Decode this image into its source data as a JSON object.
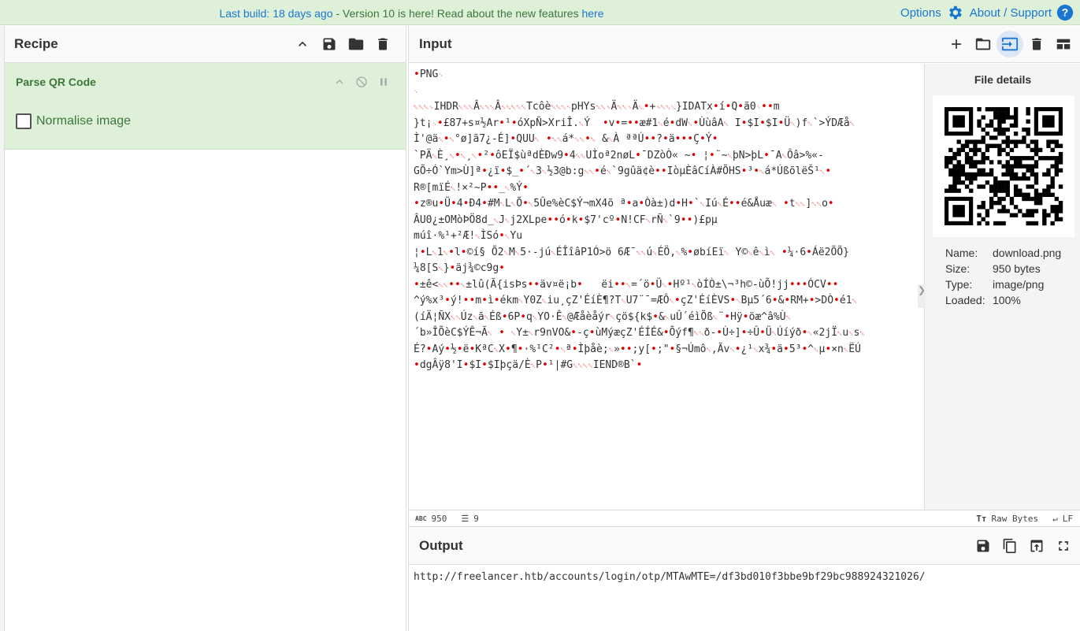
{
  "banner": {
    "last_build": "Last build: 18 days ago",
    "message": " - Version 10 is here! Read about the new features ",
    "link": "here",
    "options": "Options",
    "about": "About / Support"
  },
  "recipe": {
    "title": "Recipe",
    "operation": {
      "name": "Parse QR Code",
      "checkbox_label": "Normalise image"
    }
  },
  "input": {
    "title": "Input",
    "lines": [
      "•PNG␊",
      "␊",
      "␀␀␀␍IHDR␀␀␀Â␀␀␀Â␈␆␀␀␀Tcôè␀␀␀␉pHYs␀␀␎Ä␀␀␎Ä␁•+␎␀␀␃}IDATx•í•Q•ã0␌••m",
      "}t¡␌•£87+s¤½Ar•¹•óXpÑ>XriÎ.␀Ý  •v•=••æ#1␀é•dW␀•ÙùâA␀ I•$I•$I•Ü␀)f␀`>ÝDÆå␀",
      "Ì'@ä␀•␀°ø]ã7¿-É]•QUU␀ •␀␀á*␀␀•␀ &␀À ªªÚ••?•ä•••Ç•Ý•",
      "`PÄ␀È¸␀•␀¸␀•²•ôEÏ$ùªdÈÐw9•4␀␀UÌoª2nøL•¯DZòÒ« ~• ¦•¨~␀þN>þL•¯A␀Ôâ>%«-",
      "GÕ÷Ó`Ym>Ù]ª•¿ï•$_•´␀3␀½3@b:g␀␀•é␀`9gûä¢è••IòµÈâCíÀ#ÕHS•³•␀á*ÚßõlëŠ¹␀•",
      "R®[mïÉ␀!×²~P••_␀%Ý•",
      "•z®u•Ü•4•Ð4•#M␀L␀Õ•␀5Ûe%èC$Ý¬mX4õ ª•a•Òà±)d•H•`␀Iú␀É••é&Åuæ␀ •t␀␀]␀␀o•",
      "ÂU0¿±OMòÞÖ8d_␀J␀j2XLpe••ó•k•$7'cº•N!CF␀rÑ␀`9••)£pµ",
      "múî·%¹+²Æ!␀ÌSó•␀Yu",
      "¦•L␀1␀•l•©í§ Õ2␀M␀5·-jú␀ÉÎîâP1Ó>ö 6Æ¯␀␀ú␀ÉÖ,␀%•øbíEï␀ Y©␀ê␀ì␀ •¼·6•Áë2ÕÕ}",
      "¼8[S␀}•äj¾©c9g•",
      "•±ê<␀␀••␀±lû(Ã{isÞs••äv¤ë¡b•   ëi••␀=´ö•Ü␀•Hº¹␀òÍÒ±\\¬³h©-ùÕ!jj•••ÓCV••",
      "^ý%x³•ý!••m•ì•ékm␀Y0Z␀iu¸çZ'ÉíÈ¶?T␀U7¨¯=ÆÔ␀•çZ'ÉíÈVS•␀Bµ5´6•&•RM+•>DÒ•é1␀",
      "(íÄ¦ÑX␀␀Úz␀ã␀Éß•6P•q␀YO·Ê␀@Æåèåýr␀çö${k$•&␀uÛ´éìÕß␀¨•Hÿ•öæ^â%Ù␀",
      "´b»ÎÕèC$ÝÊ¬Ã␀ • ␀Y±␀r9nVO&•-ç•ùMýæçZ'ÉÍÉ&•Õýf¶␀␀ð-•Ù÷]•÷Û•Ü␀Úíýð•␀«2jÏ␀u␀s␀",
      "É?•Aý•½•ë•KªC␀X•¶•·%¹C²•␀ª•Ìþåè;␀»••;y[•;\"•§¬Úmô␀,Ãv␀•¿¹␀x¾•ä•5³•^␀µ•×n␀ËÚ",
      "•dgÂÿ8'I•$I•$Iþçä/È␀P•¹|#G␀␀␀␀IEND®B`•"
    ],
    "status": {
      "length": "950",
      "lines": "9",
      "format": "Raw Bytes",
      "eol": "LF"
    }
  },
  "file_details": {
    "title": "File details",
    "rows": [
      {
        "key": "Name:",
        "value": "download.png"
      },
      {
        "key": "Size:",
        "value": "950 bytes"
      },
      {
        "key": "Type:",
        "value": "image/png"
      },
      {
        "key": "Loaded:",
        "value": "100%"
      }
    ]
  },
  "output": {
    "title": "Output",
    "text": "http://freelancer.htb/accounts/login/otp/MTAwMTE=/df3bd010f3bbe9bf29bc988924321026/"
  },
  "colors": {
    "accent": "#1976d2",
    "banner_bg": "#dff0d8",
    "op_text": "#3c763d",
    "control_char": "#dd0000"
  }
}
